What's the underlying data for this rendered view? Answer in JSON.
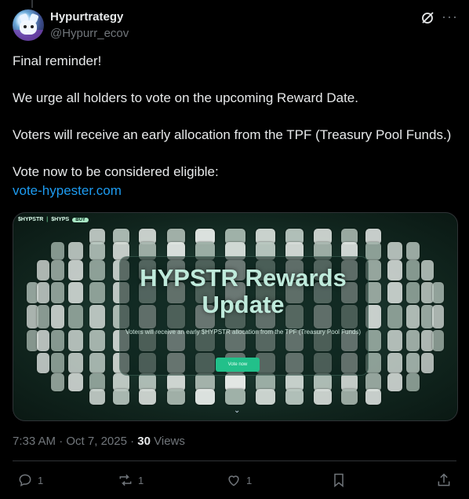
{
  "author": {
    "display_name": "Hypurtrategy",
    "handle": "@Hypurr_ecov"
  },
  "icons": {
    "grok": "grok-icon",
    "more": "more-icon",
    "reply": "reply-icon",
    "repost": "repost-icon",
    "like": "like-icon",
    "bookmark": "bookmark-icon",
    "share": "share-icon"
  },
  "tweet": {
    "line1": "Final reminder!",
    "line2": "We urge all holders to vote on the upcoming Reward Date.",
    "line3": "Voters will receive an early allocation from the TPF (Treasury Pool Funds.)",
    "line4": "Vote now to be considered eligible:",
    "link": "vote-hypester.com"
  },
  "card": {
    "ticker": "$HYPSTR",
    "price_label": "$HYPS",
    "buy_label": "BUY",
    "title_line1": "HYPSTR Rewards",
    "title_line2": "Update",
    "subtitle": "Voters will receive an early $HYPSTR allocation from the TPF (Treasury Pool Funds)",
    "button_label": "Vote now",
    "accent_color": "#22c08a"
  },
  "meta": {
    "time": "7:33 AM",
    "separator1": " · ",
    "date": "Oct 7, 2025",
    "separator2": " · ",
    "views_count": "30",
    "views_label": " Views"
  },
  "actions": {
    "replies": "1",
    "reposts": "1",
    "likes": "1"
  }
}
